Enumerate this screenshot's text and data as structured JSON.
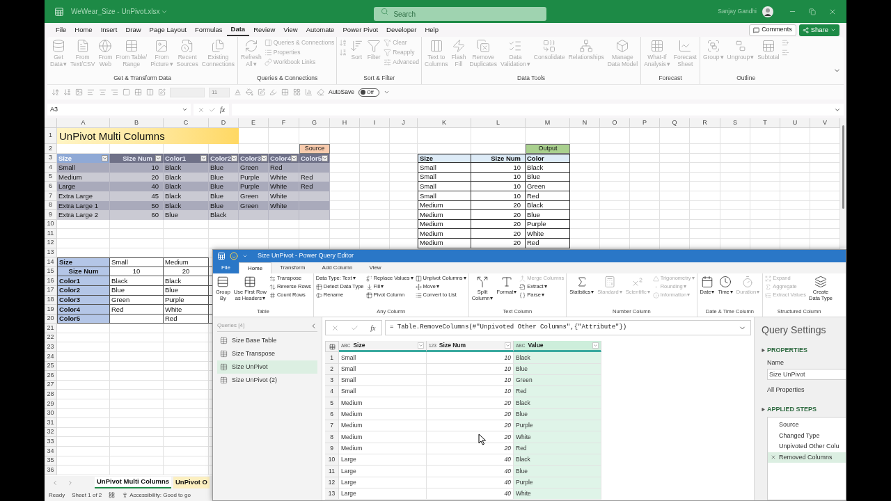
{
  "title_bar": {
    "file_name": "WeWear_Size - UnPivot.xlsx",
    "search": {
      "placeholder": "Search"
    },
    "user": "Sanjay Gandhi"
  },
  "menu_tabs": [
    {
      "label": "File",
      "selected": false
    },
    {
      "label": "Home",
      "selected": false
    },
    {
      "label": "Insert",
      "selected": false
    },
    {
      "label": "Draw",
      "selected": false
    },
    {
      "label": "Page Layout",
      "selected": false
    },
    {
      "label": "Formulas",
      "selected": false
    },
    {
      "label": "Data",
      "selected": true
    },
    {
      "label": "Review",
      "selected": false
    },
    {
      "label": "View",
      "selected": false
    },
    {
      "label": "Automate",
      "selected": false
    },
    {
      "label": "Power Pivot",
      "selected": false
    },
    {
      "label": "Developer",
      "selected": false
    },
    {
      "label": "Help",
      "selected": false
    }
  ],
  "comments": "Comments",
  "share": "Share",
  "ribbon": {
    "disabled": true,
    "groups": [
      {
        "label": "Get & Transform Data",
        "buttons": [
          {
            "kind": "large",
            "label": "Get\nData",
            "caret": "▾"
          },
          {
            "kind": "large",
            "label": "From\nText/CSV"
          },
          {
            "kind": "large",
            "label": "From\nWeb"
          },
          {
            "kind": "large",
            "label": "From Table/\nRange"
          },
          {
            "kind": "large",
            "label": "From\nPicture",
            "caret": "▾"
          },
          {
            "kind": "large",
            "label": "Recent\nSources"
          },
          {
            "kind": "large",
            "label": "Existing\nConnections"
          }
        ]
      },
      {
        "label": "Queries & Connections",
        "buttons": [
          {
            "kind": "large",
            "label": "Refresh\nAll",
            "caret": "▾"
          },
          {
            "kind": "small",
            "label": "Queries & Connections"
          },
          {
            "kind": "small",
            "label": "Properties"
          },
          {
            "kind": "small",
            "label": "Workbook Links"
          }
        ]
      },
      {
        "label": "Sort & Filter",
        "buttons": [
          {
            "kind": "icon"
          },
          {
            "kind": "icon"
          },
          {
            "kind": "large",
            "label": "Sort"
          },
          {
            "kind": "large",
            "label": "Filter"
          },
          {
            "kind": "small",
            "label": "Clear"
          },
          {
            "kind": "small",
            "label": "Reapply"
          },
          {
            "kind": "small",
            "label": "Advanced"
          }
        ]
      },
      {
        "label": "Data Tools",
        "buttons": [
          {
            "kind": "large",
            "label": "Text to\nColumns"
          },
          {
            "kind": "large",
            "label": "Flash\nFill"
          },
          {
            "kind": "large",
            "label": "Remove\nDuplicates"
          },
          {
            "kind": "large",
            "label": "Data\nValidation",
            "caret": "▾"
          },
          {
            "kind": "large",
            "label": "Consolidate"
          },
          {
            "kind": "large",
            "label": "Relationships"
          },
          {
            "kind": "large",
            "label": "Manage\nData Model"
          }
        ]
      },
      {
        "label": "Forecast",
        "buttons": [
          {
            "kind": "large",
            "label": "What-If\nAnalysis",
            "caret": "▾"
          },
          {
            "kind": "large",
            "label": "Forecast\nSheet"
          }
        ]
      },
      {
        "label": "Outline",
        "buttons": [
          {
            "kind": "large",
            "label": "Group",
            "caret": "▾"
          },
          {
            "kind": "large",
            "label": "Ungroup",
            "caret": "▾"
          },
          {
            "kind": "large",
            "label": "Subtotal"
          },
          {
            "kind": "icon"
          },
          {
            "kind": "icon"
          }
        ]
      }
    ]
  },
  "quick_toolbar": {
    "font_size": "11",
    "autosave": {
      "label": "AutoSave",
      "on": false,
      "state_text": "Off"
    }
  },
  "formula_bar": {
    "name_box": "A3",
    "fx_label": "fx"
  },
  "sheet": {
    "columns": [
      "A",
      "B",
      "C",
      "D",
      "E",
      "F",
      "G",
      "H",
      "I",
      "J",
      "K",
      "L",
      "M",
      "N",
      "O",
      "P",
      "Q",
      "R",
      "S",
      "T",
      "U",
      "V"
    ],
    "rows": [
      "1",
      "2",
      "3",
      "4",
      "5",
      "6",
      "7",
      "8",
      "9",
      "10",
      "11",
      "12",
      "13",
      "14",
      "15",
      "16",
      "17",
      "18",
      "19",
      "20",
      "21",
      "22",
      "23",
      "24",
      "25",
      "26",
      "27",
      "28",
      "29",
      "30",
      "31",
      "32",
      "33",
      "34",
      "35",
      "36"
    ],
    "title": "UnPivot Multi Columns",
    "source_label": "Source",
    "output_label": "Output",
    "source_table": {
      "columns": [
        "Size",
        "Size Num",
        "Color1",
        "Color2",
        "Color3",
        "Color4",
        "Color5"
      ],
      "rows": [
        [
          "Small",
          "10",
          "Black",
          "Blue",
          "Green",
          "Red"
        ],
        [
          "Medium",
          "20",
          "Black",
          "Blue",
          "Purple",
          "White",
          "Red"
        ],
        [
          "Large",
          "40",
          "Black",
          "Blue",
          "Purple",
          "White",
          "Red"
        ],
        [
          "Extra Large",
          "45",
          "Black",
          "Blue",
          "Green",
          "White"
        ],
        [
          "Extra Large 1",
          "50",
          "Black",
          "Blue",
          "Green",
          "White"
        ],
        [
          "Extra Large 2",
          "60",
          "Blue",
          "Black"
        ]
      ]
    },
    "output_table": {
      "columns": [
        "Size",
        "Size Num",
        "Color"
      ],
      "rows": [
        [
          "Small",
          "10",
          "Black"
        ],
        [
          "Small",
          "10",
          "Blue"
        ],
        [
          "Small",
          "10",
          "Green"
        ],
        [
          "Small",
          "10",
          "Red"
        ],
        [
          "Medium",
          "20",
          "Black"
        ],
        [
          "Medium",
          "20",
          "Blue"
        ],
        [
          "Medium",
          "20",
          "Purple"
        ],
        [
          "Medium",
          "20",
          "White"
        ],
        [
          "Medium",
          "20",
          "Red"
        ]
      ]
    },
    "transpose_table": [
      {
        "label": "Size",
        "kind": "text",
        "column_b": "Small",
        "column_c": "Medium"
      },
      {
        "label": "Size Num",
        "kind": "number",
        "column_b": "10",
        "column_c": "20"
      },
      {
        "label": "Color1",
        "kind": "text",
        "column_b": "Black",
        "column_c": "Black"
      },
      {
        "label": "Color2",
        "kind": "text",
        "column_b": "Blue",
        "column_c": "Blue"
      },
      {
        "label": "Color3",
        "kind": "text",
        "column_b": "Green",
        "column_c": "Purple"
      },
      {
        "label": "Color4",
        "kind": "text",
        "column_b": "Red",
        "column_c": "White"
      },
      {
        "label": "Color5",
        "kind": "text",
        "column_c": "Red"
      }
    ]
  },
  "sheet_tabs": [
    {
      "label": "UnPivot Multi Columns",
      "selected": true
    },
    {
      "label": "UnPivot O",
      "selected": false,
      "color": "#fcefc0"
    }
  ],
  "status_bar": {
    "ready": "Ready",
    "sheet_count": "Sheet 1 of 2",
    "accessibility": "Accessibility: Good to go"
  },
  "power_query": {
    "title": "Size UnPivot - Power Query Editor",
    "tabs": [
      {
        "label": "File",
        "kind": "file",
        "selected": false
      },
      {
        "label": "Home",
        "kind": "tab",
        "selected": true
      },
      {
        "label": "Transform",
        "kind": "tab",
        "selected": false
      },
      {
        "label": "Add Column",
        "kind": "tab",
        "selected": false
      },
      {
        "label": "View",
        "kind": "tab",
        "selected": false
      }
    ],
    "ribbon_groups": [
      {
        "label": "Table",
        "buttons": [
          {
            "kind": "large",
            "label": "Group\nBy",
            "disabled": false
          },
          {
            "kind": "large",
            "label": "Use First Row\nas Headers",
            "caret": "▾",
            "disabled": false
          },
          {
            "kind": "small",
            "label": "Transpose",
            "disabled": false
          },
          {
            "kind": "small",
            "label": "Reverse Rows",
            "disabled": false
          },
          {
            "kind": "small",
            "label": "Count Rows",
            "disabled": false
          }
        ]
      },
      {
        "label": "Any Column",
        "buttons": [
          {
            "kind": "small",
            "label": "Data Type: Text",
            "caret": "▾",
            "disabled": false
          },
          {
            "kind": "small",
            "label": "Detect Data Type",
            "disabled": false
          },
          {
            "kind": "small",
            "label": "Rename",
            "disabled": false
          },
          {
            "kind": "small",
            "label": "Replace Values",
            "caret": "▾",
            "disabled": false
          },
          {
            "kind": "small",
            "label": "Fill",
            "caret": "▾",
            "disabled": false
          },
          {
            "kind": "small",
            "label": "Pivot Column",
            "disabled": false
          },
          {
            "kind": "small",
            "label": "Unpivot Columns",
            "caret": "▾",
            "disabled": false
          },
          {
            "kind": "small",
            "label": "Move",
            "caret": "▾",
            "disabled": false
          },
          {
            "kind": "small",
            "label": "Convert to List",
            "disabled": false
          }
        ]
      },
      {
        "label": "Text Column",
        "buttons": [
          {
            "kind": "large",
            "label": "Split\nColumn",
            "caret": "▾",
            "disabled": false
          },
          {
            "kind": "large",
            "label": "Format",
            "caret": "▾",
            "disabled": false
          },
          {
            "kind": "small",
            "label": "Merge Columns",
            "disabled": true
          },
          {
            "kind": "small",
            "label": "Extract",
            "caret": "▾",
            "disabled": false
          },
          {
            "kind": "small",
            "label": "Parse",
            "caret": "▾",
            "disabled": false
          }
        ]
      },
      {
        "label": "Number Column",
        "buttons": [
          {
            "kind": "large",
            "label": "Statistics",
            "caret": "▾",
            "disabled": false
          },
          {
            "kind": "large",
            "label": "Standard",
            "caret": "▾",
            "disabled": true
          },
          {
            "kind": "large",
            "label": "Scientific",
            "caret": "▾",
            "disabled": true
          },
          {
            "kind": "small",
            "label": "Trigonometry",
            "caret": "▾",
            "disabled": true
          },
          {
            "kind": "small",
            "label": "Rounding",
            "caret": "▾",
            "disabled": true
          },
          {
            "kind": "small",
            "label": "Information",
            "caret": "▾",
            "disabled": true
          }
        ]
      },
      {
        "label": "Date & Time Column",
        "buttons": [
          {
            "kind": "large",
            "label": "Date",
            "caret": "▾",
            "disabled": false
          },
          {
            "kind": "large",
            "label": "Time",
            "caret": "▾",
            "disabled": false
          },
          {
            "kind": "large",
            "label": "Duration",
            "caret": "▾",
            "disabled": true
          }
        ]
      },
      {
        "label": "Structured Column",
        "buttons": [
          {
            "kind": "small",
            "label": "Expand",
            "disabled": true
          },
          {
            "kind": "small",
            "label": "Aggregate",
            "disabled": true
          },
          {
            "kind": "small",
            "label": "Extract Values",
            "disabled": true
          },
          {
            "kind": "large",
            "label": "Create\nData Type",
            "disabled": false
          }
        ]
      }
    ],
    "queries_header": "Queries [4]",
    "queries": [
      {
        "label": "Size Base Table",
        "selected": false
      },
      {
        "label": "Size Transpose",
        "selected": false
      },
      {
        "label": "Size UnPivot",
        "selected": true
      },
      {
        "label": "Size UnPivot (2)",
        "selected": false
      }
    ],
    "fx_label": "fx",
    "formula": "= Table.RemoveColumns(#\"Unpivoted Other Columns\",{\"Attribute\"})",
    "columns": [
      {
        "name": "Size",
        "type": "ABC",
        "kind": "text",
        "selected": false
      },
      {
        "name": "Size Num",
        "type": "123",
        "kind": "number",
        "selected": false
      },
      {
        "name": "Value",
        "type": "ABC",
        "kind": "text",
        "selected": true
      }
    ],
    "rows": [
      {
        "number": "1",
        "cells": [
          "Small",
          "10",
          "Black"
        ]
      },
      {
        "number": "2",
        "cells": [
          "Small",
          "10",
          "Blue"
        ]
      },
      {
        "number": "3",
        "cells": [
          "Small",
          "10",
          "Green"
        ]
      },
      {
        "number": "4",
        "cells": [
          "Small",
          "10",
          "Red"
        ]
      },
      {
        "number": "5",
        "cells": [
          "Medium",
          "20",
          "Black"
        ]
      },
      {
        "number": "6",
        "cells": [
          "Medium",
          "20",
          "Blue"
        ]
      },
      {
        "number": "7",
        "cells": [
          "Medium",
          "20",
          "Purple"
        ]
      },
      {
        "number": "8",
        "cells": [
          "Medium",
          "20",
          "White"
        ]
      },
      {
        "number": "9",
        "cells": [
          "Medium",
          "20",
          "Red"
        ]
      },
      {
        "number": "10",
        "cells": [
          "Large",
          "40",
          "Black"
        ]
      },
      {
        "number": "11",
        "cells": [
          "Large",
          "40",
          "Blue"
        ]
      },
      {
        "number": "12",
        "cells": [
          "Large",
          "40",
          "Purple"
        ]
      },
      {
        "number": "13",
        "cells": [
          "Large",
          "40",
          "White"
        ]
      }
    ],
    "settings": {
      "title": "Query Settings",
      "properties_heading": "PROPERTIES",
      "name_label": "Name",
      "name_value": "Size UnPivot",
      "all_properties": "All Properties",
      "steps_heading": "APPLIED STEPS",
      "steps": [
        {
          "label": "Source",
          "selected": false
        },
        {
          "label": "Changed Type",
          "selected": false
        },
        {
          "label": "Unpivoted Other Colu",
          "selected": false
        },
        {
          "label": "Removed Columns",
          "selected": true
        }
      ]
    }
  }
}
